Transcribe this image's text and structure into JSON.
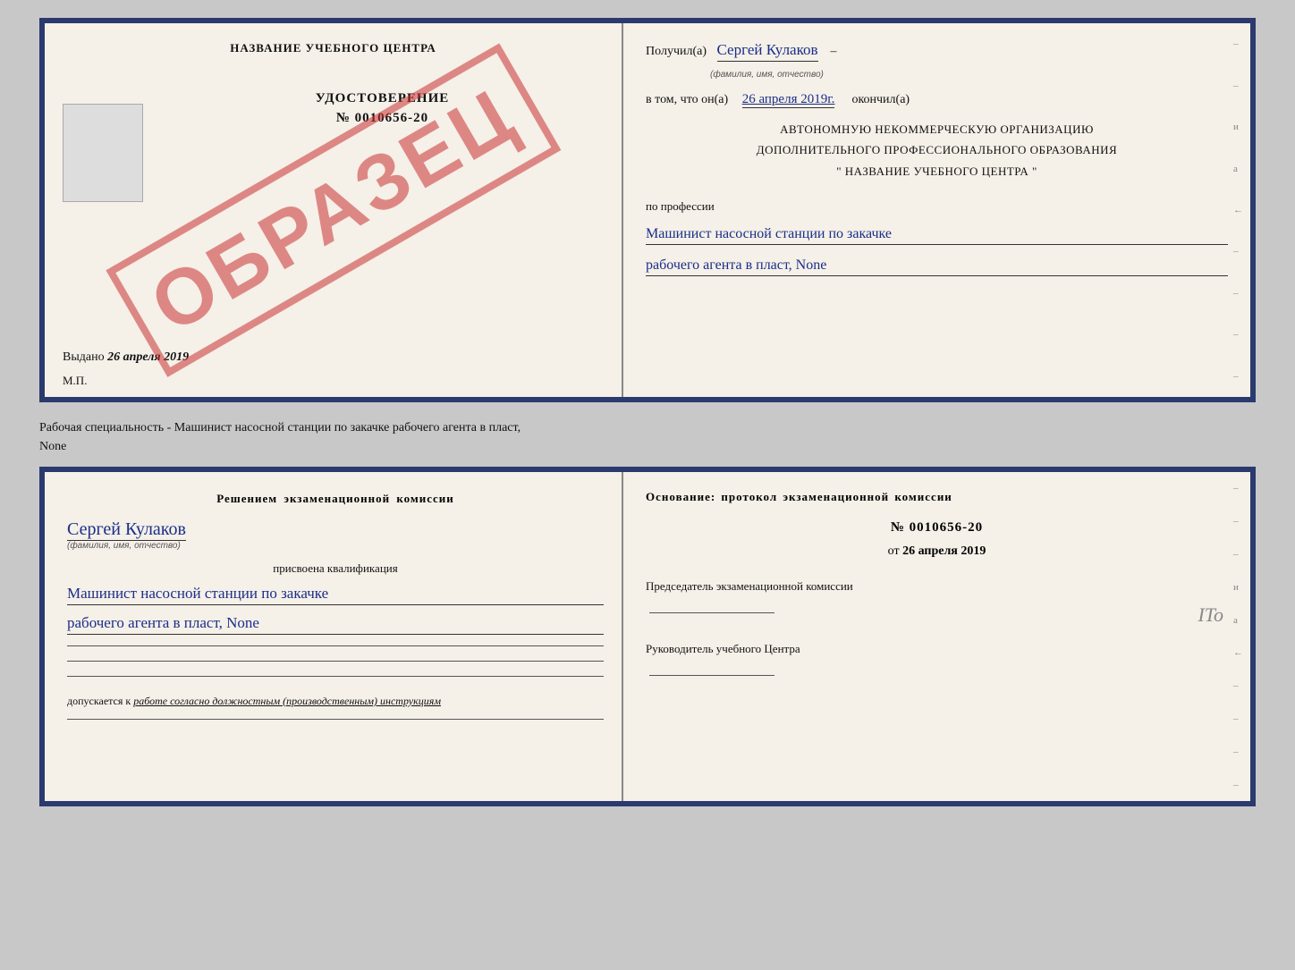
{
  "top_doc": {
    "left": {
      "school_name": "НАЗВАНИЕ УЧЕБНОГО ЦЕНТРА",
      "cert_title": "УДОСТОВЕРЕНИЕ",
      "cert_number": "№ 0010656-20",
      "issued_label": "Выдано",
      "issued_date": "26 апреля 2019",
      "mp": "М.П.",
      "obrazets": "ОБРАЗЕЦ"
    },
    "right": {
      "received_label": "Получил(а)",
      "recipient_name": "Сергей Кулаков",
      "fio_sub": "(фамилия, имя, отчество)",
      "in_that_label": "в том, что он(а)",
      "date_value": "26 апреля 2019г.",
      "finished_label": "окончил(а)",
      "org_line1": "АВТОНОМНУЮ НЕКОММЕРЧЕСКУЮ ОРГАНИЗАЦИЮ",
      "org_line2": "ДОПОЛНИТЕЛЬНОГО ПРОФЕССИОНАЛЬНОГО ОБРАЗОВАНИЯ",
      "org_line3": "\" НАЗВАНИЕ УЧЕБНОГО ЦЕНТРА \"",
      "profession_label": "по профессии",
      "profession_line1": "Машинист насосной станции по закачке",
      "profession_line2": "рабочего агента в пласт, None"
    }
  },
  "middle": {
    "text": "Рабочая специальность - Машинист насосной станции по закачке рабочего агента в пласт,",
    "text2": "None"
  },
  "bottom_doc": {
    "left": {
      "commission_title": "Решением экзаменационной комиссии",
      "name": "Сергей Кулаков",
      "fio_sub": "(фамилия, имя, отчество)",
      "assigned": "присвоена квалификация",
      "qual_line1": "Машинист насосной станции по закачке",
      "qual_line2": "рабочего агента в пласт, None",
      "allowed_label": "допускается к",
      "allowed_text": "работе согласно должностным (производственным) инструкциям"
    },
    "right": {
      "basis_title": "Основание: протокол экзаменационной комиссии",
      "protocol_number": "№ 0010656-20",
      "protocol_date_prefix": "от",
      "protocol_date": "26 апреля 2019",
      "chairman_label": "Председатель экзаменационной комиссии",
      "head_label": "Руководитель учебного Центра",
      "ito_text": "ITo"
    }
  }
}
